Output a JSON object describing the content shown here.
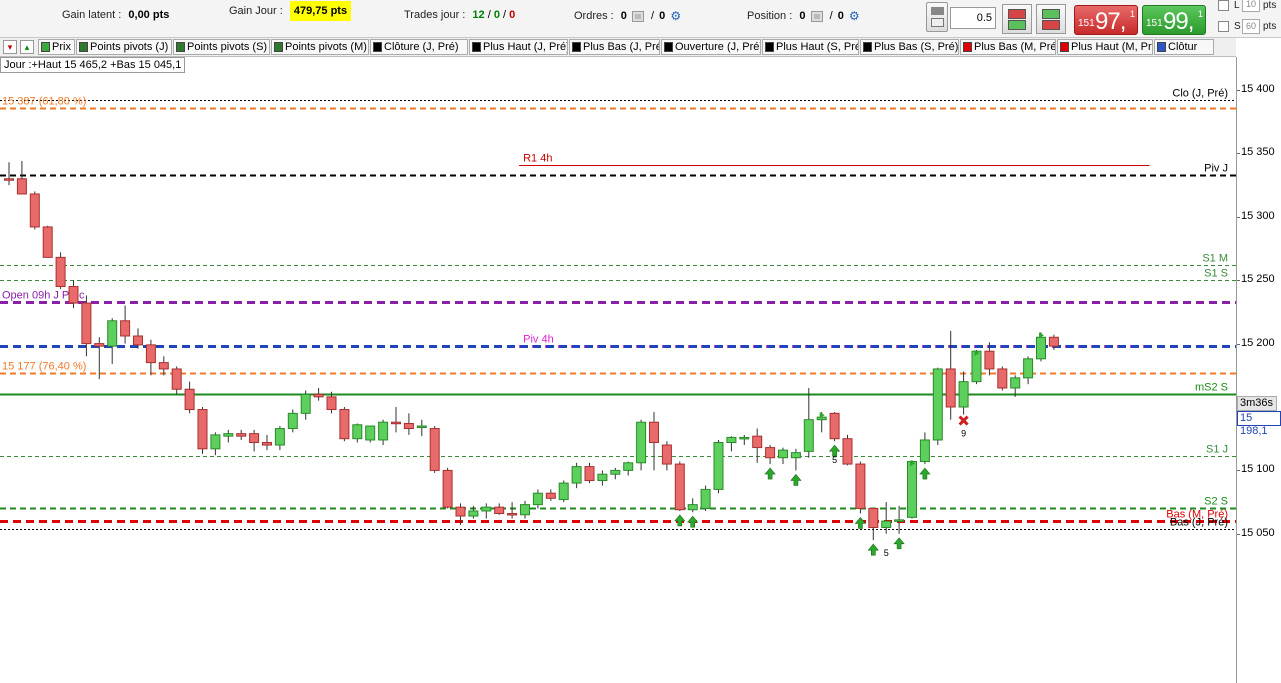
{
  "status_bar": {
    "gain_latent_label": "Gain latent :",
    "gain_latent_value": "0,00 pts",
    "gain_jour_label": "Gain Jour :",
    "gain_jour_value": "479,75 pts",
    "trades_label": "Trades jour :",
    "trades_total": "12",
    "trades_won": "0",
    "trades_lost": "0",
    "ordres_label": "Ordres :",
    "ordres_a": "0",
    "ordres_b": "0",
    "position_label": "Position :",
    "position_a": "0",
    "position_b": "0"
  },
  "order_panel": {
    "quantity": "0.5",
    "sell_small": "151",
    "sell_big": "97,",
    "sell_sup": "1",
    "buy_small": "151",
    "buy_big": "99,",
    "buy_sup": "1",
    "opt_l": "L",
    "opt_s": "S",
    "pts_label": "pts",
    "pts_10": "10",
    "pts_60": "60"
  },
  "toolbar": {
    "indicators": [
      {
        "label": "Prix",
        "color": "#3aaa3a"
      },
      {
        "label": "Points pivots (J)",
        "color": "#2d7a2d"
      },
      {
        "label": "Points pivots (S)",
        "color": "#2d7a2d"
      },
      {
        "label": "Points pivots (M)",
        "color": "#2d7a2d"
      },
      {
        "label": "Clôture (J, Pré)",
        "color": "#000000"
      },
      {
        "label": "Plus Haut (J, Pré)",
        "color": "#000000"
      },
      {
        "label": "Plus Bas (J, Pré)",
        "color": "#000000"
      },
      {
        "label": "Ouverture (J, Pré)",
        "color": "#000000"
      },
      {
        "label": "Plus Haut (S, Pré)",
        "color": "#000000"
      },
      {
        "label": "Plus Bas (S, Pré)",
        "color": "#000000"
      },
      {
        "label": "Plus Bas (M, Pré)",
        "color": "#e00000"
      },
      {
        "label": "Plus Haut (M, Pré)",
        "color": "#e00000"
      },
      {
        "label": "Clôtur",
        "color": "#2a56c6"
      }
    ]
  },
  "chart_data": {
    "type": "candlestick",
    "instrument_range_label": "Jour :+Haut 15 465,2 +Bas 15 045,1",
    "y_ticks": [
      "15 400",
      "15 350",
      "15 300",
      "15 250",
      "15 200",
      "15 150",
      "15 100",
      "15 050"
    ],
    "y_tick_values": [
      15400,
      15350,
      15300,
      15250,
      15200,
      15150,
      15100,
      15050
    ],
    "last_price_label": "15 198,1",
    "timer_label": "3m36s",
    "levels": [
      {
        "name": "Clo (J, Pré)",
        "value": 15392,
        "color": "#000000",
        "style": "dotted",
        "label": "Clo (J, Pré)",
        "label_side": "right"
      },
      {
        "name": "fib-61.8",
        "value": 15386,
        "color": "#f07a2a",
        "style": "dashed",
        "label": "15 387 (61,80 %)",
        "label_side": "left"
      },
      {
        "name": "R1 4h",
        "value": 15341,
        "color": "#cc0000",
        "style": "solid",
        "label": "R1 4h",
        "label_side": "mid",
        "x_from": 0.42,
        "x_to": 0.93
      },
      {
        "name": "Piv J",
        "value": 15333,
        "color": "#000000",
        "style": "dashed",
        "label": "Piv J",
        "label_side": "right"
      },
      {
        "name": "S1 M",
        "value": 15262,
        "color": "#3a8a3a",
        "style": "dashed-thin",
        "label": "S1 M",
        "label_side": "right"
      },
      {
        "name": "S1 S",
        "value": 15250,
        "color": "#3a8a3a",
        "style": "dashed-thin",
        "label": "S1 S",
        "label_side": "right"
      },
      {
        "name": "Open 09h J Préc",
        "value": 15233,
        "color": "#8a1fa8",
        "style": "dashed-thick",
        "label": "Open 09h J Préc",
        "label_side": "left"
      },
      {
        "name": "Piv 4h",
        "value": 15198,
        "color": "#e020d0",
        "style": "dashed-thick",
        "label": "Piv 4h",
        "label_side": "mid",
        "x_from": 0.42,
        "x_to": 0.93
      },
      {
        "name": "last-price",
        "value": 15198,
        "color": "#1f45b8",
        "style": "dashed-thick",
        "label": "",
        "label_side": "none"
      },
      {
        "name": "fib-76.4",
        "value": 15177,
        "color": "#f07a2a",
        "style": "dashed",
        "label": "15 177 (76,40 %)",
        "label_side": "left"
      },
      {
        "name": "mS2 S",
        "value": 15160,
        "color": "#1d8a1d",
        "style": "solid",
        "label": "mS2 S",
        "label_side": "right"
      },
      {
        "name": "S1 J",
        "value": 15111,
        "color": "#3a8a3a",
        "style": "dashed-thin",
        "label": "S1 J",
        "label_side": "right"
      },
      {
        "name": "S2 S",
        "value": 15070,
        "color": "#1d8a1d",
        "style": "dashed",
        "label": "S2 S",
        "label_side": "right"
      },
      {
        "name": "Bas (M, Pré)",
        "value": 15060,
        "color": "#e00000",
        "style": "dashed-thick",
        "label": "Bas (M, Pré)",
        "label_side": "right"
      },
      {
        "name": "Bas (J, Pré)",
        "value": 15054,
        "color": "#000000",
        "style": "dotted",
        "label": "Bas (J, Pré)",
        "label_side": "right"
      }
    ],
    "candles": [
      {
        "o": 15330,
        "h": 15343,
        "l": 15325,
        "c": 15329
      },
      {
        "o": 15330,
        "h": 15344,
        "l": 15318,
        "c": 15318
      },
      {
        "o": 15318,
        "h": 15320,
        "l": 15290,
        "c": 15292
      },
      {
        "o": 15292,
        "h": 15293,
        "l": 15268,
        "c": 15268
      },
      {
        "o": 15268,
        "h": 15272,
        "l": 15243,
        "c": 15245
      },
      {
        "o": 15245,
        "h": 15250,
        "l": 15228,
        "c": 15232
      },
      {
        "o": 15232,
        "h": 15238,
        "l": 15190,
        "c": 15200
      },
      {
        "o": 15200,
        "h": 15205,
        "l": 15172,
        "c": 15198
      },
      {
        "o": 15198,
        "h": 15220,
        "l": 15184,
        "c": 15218
      },
      {
        "o": 15218,
        "h": 15230,
        "l": 15200,
        "c": 15206
      },
      {
        "o": 15206,
        "h": 15212,
        "l": 15196,
        "c": 15199
      },
      {
        "o": 15199,
        "h": 15203,
        "l": 15175,
        "c": 15185
      },
      {
        "o": 15185,
        "h": 15190,
        "l": 15175,
        "c": 15180
      },
      {
        "o": 15180,
        "h": 15182,
        "l": 15160,
        "c": 15164
      },
      {
        "o": 15164,
        "h": 15170,
        "l": 15145,
        "c": 15148
      },
      {
        "o": 15148,
        "h": 15150,
        "l": 15113,
        "c": 15117
      },
      {
        "o": 15117,
        "h": 15130,
        "l": 15112,
        "c": 15128
      },
      {
        "o": 15127,
        "h": 15132,
        "l": 15122,
        "c": 15129
      },
      {
        "o": 15129,
        "h": 15132,
        "l": 15124,
        "c": 15127
      },
      {
        "o": 15129,
        "h": 15132,
        "l": 15115,
        "c": 15122
      },
      {
        "o": 15122,
        "h": 15128,
        "l": 15116,
        "c": 15120
      },
      {
        "o": 15120,
        "h": 15135,
        "l": 15116,
        "c": 15133
      },
      {
        "o": 15133,
        "h": 15148,
        "l": 15130,
        "c": 15145
      },
      {
        "o": 15145,
        "h": 15163,
        "l": 15140,
        "c": 15160
      },
      {
        "o": 15160,
        "h": 15165,
        "l": 15155,
        "c": 15158
      },
      {
        "o": 15158,
        "h": 15162,
        "l": 15145,
        "c": 15148
      },
      {
        "o": 15148,
        "h": 15150,
        "l": 15123,
        "c": 15125
      },
      {
        "o": 15125,
        "h": 15137,
        "l": 15122,
        "c": 15136
      },
      {
        "o": 15124,
        "h": 15135,
        "l": 15122,
        "c": 15135
      },
      {
        "o": 15124,
        "h": 15140,
        "l": 15120,
        "c": 15138
      },
      {
        "o": 15138,
        "h": 15150,
        "l": 15130,
        "c": 15137
      },
      {
        "o": 15137,
        "h": 15145,
        "l": 15128,
        "c": 15133
      },
      {
        "o": 15135,
        "h": 15140,
        "l": 15127,
        "c": 15135
      },
      {
        "o": 15133,
        "h": 15135,
        "l": 15098,
        "c": 15100
      },
      {
        "o": 15100,
        "h": 15102,
        "l": 15070,
        "c": 15071
      },
      {
        "o": 15071,
        "h": 15074,
        "l": 15057,
        "c": 15064
      },
      {
        "o": 15064,
        "h": 15072,
        "l": 15062,
        "c": 15068
      },
      {
        "o": 15068,
        "h": 15074,
        "l": 15062,
        "c": 15071
      },
      {
        "o": 15071,
        "h": 15074,
        "l": 15065,
        "c": 15066
      },
      {
        "o": 15066,
        "h": 15075,
        "l": 15062,
        "c": 15065
      },
      {
        "o": 15065,
        "h": 15076,
        "l": 15062,
        "c": 15073
      },
      {
        "o": 15073,
        "h": 15085,
        "l": 15070,
        "c": 15082
      },
      {
        "o": 15082,
        "h": 15085,
        "l": 15076,
        "c": 15078
      },
      {
        "o": 15077,
        "h": 15092,
        "l": 15075,
        "c": 15090
      },
      {
        "o": 15090,
        "h": 15106,
        "l": 15086,
        "c": 15103
      },
      {
        "o": 15103,
        "h": 15106,
        "l": 15090,
        "c": 15092
      },
      {
        "o": 15092,
        "h": 15100,
        "l": 15088,
        "c": 15097
      },
      {
        "o": 15097,
        "h": 15102,
        "l": 15093,
        "c": 15100
      },
      {
        "o": 15100,
        "h": 15107,
        "l": 15096,
        "c": 15106
      },
      {
        "o": 15106,
        "h": 15140,
        "l": 15100,
        "c": 15138
      },
      {
        "o": 15138,
        "h": 15146,
        "l": 15100,
        "c": 15122
      },
      {
        "o": 15120,
        "h": 15123,
        "l": 15100,
        "c": 15105
      },
      {
        "o": 15105,
        "h": 15107,
        "l": 15068,
        "c": 15069
      },
      {
        "o": 15069,
        "h": 15078,
        "l": 15067,
        "c": 15073
      },
      {
        "o": 15070,
        "h": 15088,
        "l": 15068,
        "c": 15085
      },
      {
        "o": 15085,
        "h": 15124,
        "l": 15082,
        "c": 15122
      },
      {
        "o": 15122,
        "h": 15127,
        "l": 15115,
        "c": 15126
      },
      {
        "o": 15126,
        "h": 15128,
        "l": 15120,
        "c": 15126
      },
      {
        "o": 15127,
        "h": 15133,
        "l": 15106,
        "c": 15118
      },
      {
        "o": 15118,
        "h": 15120,
        "l": 15105,
        "c": 15110
      },
      {
        "o": 15110,
        "h": 15118,
        "l": 15105,
        "c": 15116
      },
      {
        "o": 15110,
        "h": 15117,
        "l": 15100,
        "c": 15114
      },
      {
        "o": 15115,
        "h": 15165,
        "l": 15110,
        "c": 15140
      },
      {
        "o": 15140,
        "h": 15146,
        "l": 15130,
        "c": 15142
      },
      {
        "o": 15145,
        "h": 15146,
        "l": 15123,
        "c": 15125
      },
      {
        "o": 15125,
        "h": 15128,
        "l": 15104,
        "c": 15105
      },
      {
        "o": 15105,
        "h": 15107,
        "l": 15066,
        "c": 15070
      },
      {
        "o": 15070,
        "h": 15070,
        "l": 15045,
        "c": 15055
      },
      {
        "o": 15055,
        "h": 15075,
        "l": 15050,
        "c": 15060
      },
      {
        "o": 15060,
        "h": 15072,
        "l": 15050,
        "c": 15061
      },
      {
        "o": 15063,
        "h": 15108,
        "l": 15062,
        "c": 15107
      },
      {
        "o": 15107,
        "h": 15130,
        "l": 15105,
        "c": 15124
      },
      {
        "o": 15124,
        "h": 15181,
        "l": 15120,
        "c": 15180
      },
      {
        "o": 15180,
        "h": 15210,
        "l": 15140,
        "c": 15150
      },
      {
        "o": 15150,
        "h": 15178,
        "l": 15144,
        "c": 15170
      },
      {
        "o": 15170,
        "h": 15195,
        "l": 15168,
        "c": 15194
      },
      {
        "o": 15194,
        "h": 15201,
        "l": 15175,
        "c": 15180
      },
      {
        "o": 15180,
        "h": 15182,
        "l": 15163,
        "c": 15165
      },
      {
        "o": 15165,
        "h": 15175,
        "l": 15158,
        "c": 15173
      },
      {
        "o": 15173,
        "h": 15190,
        "l": 15168,
        "c": 15188
      },
      {
        "o": 15188,
        "h": 15209,
        "l": 15186,
        "c": 15205
      },
      {
        "o": 15205,
        "h": 15207,
        "l": 15195,
        "c": 15198
      }
    ],
    "markers": [
      {
        "type": "up-arrow",
        "candle": 52
      },
      {
        "type": "up-arrow",
        "candle": 53
      },
      {
        "type": "up-arrow",
        "candle": 59
      },
      {
        "type": "up-arrow",
        "candle": 61
      },
      {
        "type": "up-arrow",
        "candle": 64
      },
      {
        "type": "up-arrow",
        "candle": 66
      },
      {
        "type": "up-arrow",
        "candle": 67
      },
      {
        "type": "up-arrow",
        "candle": 69
      },
      {
        "type": "up-arrow",
        "candle": 71
      },
      {
        "type": "flag",
        "candle": 63
      },
      {
        "type": "flag",
        "candle": 70
      },
      {
        "type": "flag",
        "candle": 75
      },
      {
        "type": "flag",
        "candle": 80
      },
      {
        "type": "cross",
        "candle": 74
      }
    ],
    "marker_labels": [
      {
        "text": "5",
        "candle": 64
      },
      {
        "text": "5",
        "candle": 68
      },
      {
        "text": "9",
        "candle": 74
      }
    ]
  }
}
